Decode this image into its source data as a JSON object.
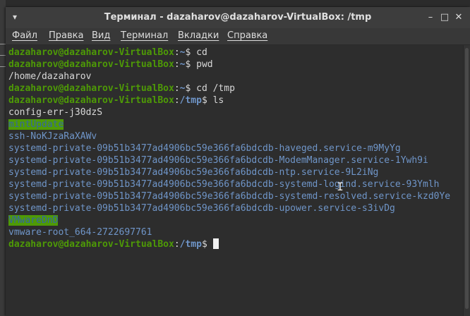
{
  "window": {
    "title": "Терминал - dazaharov@dazaharov-VirtualBox: /tmp",
    "left_icon": "terminal-menu-icon",
    "controls": {
      "minimize": "–",
      "maximize": "□",
      "close": "✕"
    }
  },
  "menubar": {
    "items": [
      "Файл",
      "Правка",
      "Вид",
      "Терминал",
      "Вкладки",
      "Справка"
    ]
  },
  "terminal": {
    "prompt_user": "dazaharov@dazaharov-VirtualBox",
    "prompt_sep": ":",
    "lines": [
      {
        "kind": "prompt",
        "path": "~",
        "command": "cd"
      },
      {
        "kind": "prompt",
        "path": "~",
        "command": "pwd"
      },
      {
        "kind": "output",
        "text": "/home/dazaharov"
      },
      {
        "kind": "prompt",
        "path": "~",
        "command": "cd /tmp"
      },
      {
        "kind": "prompt",
        "path": "/tmp",
        "command": "ls"
      },
      {
        "kind": "file",
        "text": "config-err-j30dzS"
      },
      {
        "kind": "dir-hl",
        "text": "mintUpdate"
      },
      {
        "kind": "dir",
        "text": "ssh-NoKJzaRaXAWv"
      },
      {
        "kind": "dir",
        "text": "systemd-private-09b51b3477ad4906bc59e366fa6bdcdb-haveged.service-m9MyYg"
      },
      {
        "kind": "dir",
        "text": "systemd-private-09b51b3477ad4906bc59e366fa6bdcdb-ModemManager.service-1Ywh9i"
      },
      {
        "kind": "dir",
        "text": "systemd-private-09b51b3477ad4906bc59e366fa6bdcdb-ntp.service-9L2iNg"
      },
      {
        "kind": "dir",
        "text": "systemd-private-09b51b3477ad4906bc59e366fa6bdcdb-systemd-logind.service-93Ymlh"
      },
      {
        "kind": "dir",
        "text": "systemd-private-09b51b3477ad4906bc59e366fa6bdcdb-systemd-resolved.service-kzd0Ye"
      },
      {
        "kind": "dir",
        "text": "systemd-private-09b51b3477ad4906bc59e366fa6bdcdb-upower.service-s3ivDg"
      },
      {
        "kind": "dir-hl",
        "text": "VMwareDnD"
      },
      {
        "kind": "dir",
        "text": "vmware-root_664-2722697761"
      },
      {
        "kind": "prompt",
        "path": "/tmp",
        "command": ""
      }
    ]
  },
  "colors": {
    "prompt_user": "#4e9a06",
    "prompt_path": "#6f95c8",
    "highlight_bg": "#4e9a06",
    "background": "#2d2d2d"
  }
}
